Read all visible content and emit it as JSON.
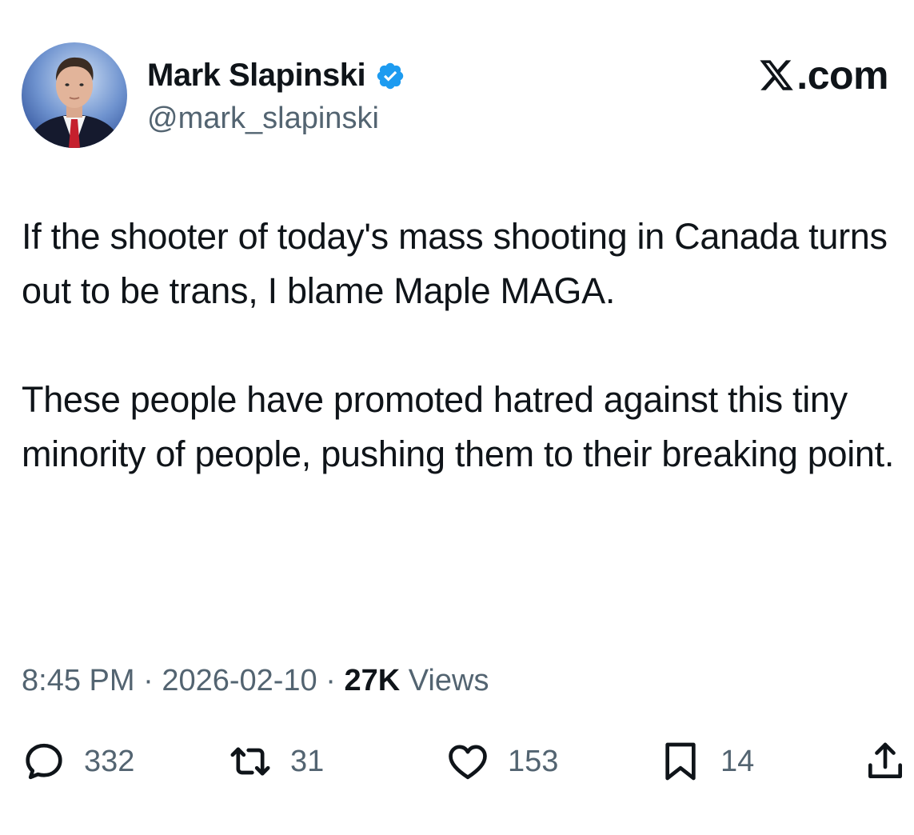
{
  "author": {
    "display_name": "Mark Slapinski",
    "handle": "@mark_slapinski",
    "verified": true,
    "verified_color": "#1d9bf0"
  },
  "brand": {
    "icon": "x-logo-icon",
    "text": ".com"
  },
  "tweet": {
    "paragraphs": [
      "If the shooter of today's mass shooting in Canada turns out to be trans, I blame Maple MAGA.",
      "These people have promoted hatred against this tiny minority of people, pushing them to their breaking point."
    ]
  },
  "meta": {
    "time": "8:45 PM",
    "separator": " · ",
    "date": "2026-02-10",
    "views_count": "27K",
    "views_label": " Views"
  },
  "actions": {
    "replies": {
      "icon": "reply-icon",
      "count": "332"
    },
    "reposts": {
      "icon": "repost-icon",
      "count": "31"
    },
    "likes": {
      "icon": "heart-icon",
      "count": "153"
    },
    "bookmarks": {
      "icon": "bookmark-icon",
      "count": "14"
    },
    "share": {
      "icon": "share-icon"
    }
  },
  "colors": {
    "text_primary": "#0f1419",
    "text_secondary": "#536471",
    "background": "#ffffff"
  }
}
